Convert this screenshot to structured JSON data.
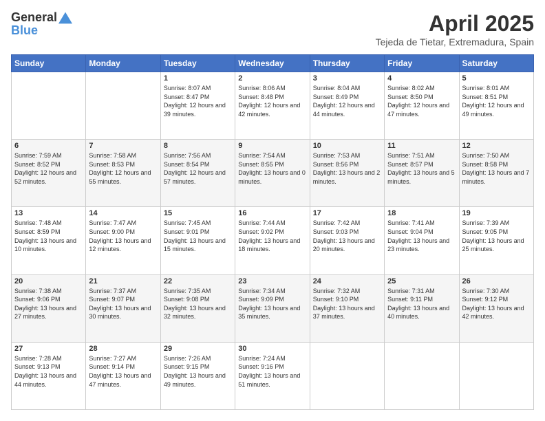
{
  "logo": {
    "line1": "General",
    "line2": "Blue"
  },
  "title": "April 2025",
  "subtitle": "Tejeda de Tietar, Extremadura, Spain",
  "days_header": [
    "Sunday",
    "Monday",
    "Tuesday",
    "Wednesday",
    "Thursday",
    "Friday",
    "Saturday"
  ],
  "weeks": [
    [
      {
        "num": "",
        "info": ""
      },
      {
        "num": "",
        "info": ""
      },
      {
        "num": "1",
        "info": "Sunrise: 8:07 AM\nSunset: 8:47 PM\nDaylight: 12 hours and 39 minutes."
      },
      {
        "num": "2",
        "info": "Sunrise: 8:06 AM\nSunset: 8:48 PM\nDaylight: 12 hours and 42 minutes."
      },
      {
        "num": "3",
        "info": "Sunrise: 8:04 AM\nSunset: 8:49 PM\nDaylight: 12 hours and 44 minutes."
      },
      {
        "num": "4",
        "info": "Sunrise: 8:02 AM\nSunset: 8:50 PM\nDaylight: 12 hours and 47 minutes."
      },
      {
        "num": "5",
        "info": "Sunrise: 8:01 AM\nSunset: 8:51 PM\nDaylight: 12 hours and 49 minutes."
      }
    ],
    [
      {
        "num": "6",
        "info": "Sunrise: 7:59 AM\nSunset: 8:52 PM\nDaylight: 12 hours and 52 minutes."
      },
      {
        "num": "7",
        "info": "Sunrise: 7:58 AM\nSunset: 8:53 PM\nDaylight: 12 hours and 55 minutes."
      },
      {
        "num": "8",
        "info": "Sunrise: 7:56 AM\nSunset: 8:54 PM\nDaylight: 12 hours and 57 minutes."
      },
      {
        "num": "9",
        "info": "Sunrise: 7:54 AM\nSunset: 8:55 PM\nDaylight: 13 hours and 0 minutes."
      },
      {
        "num": "10",
        "info": "Sunrise: 7:53 AM\nSunset: 8:56 PM\nDaylight: 13 hours and 2 minutes."
      },
      {
        "num": "11",
        "info": "Sunrise: 7:51 AM\nSunset: 8:57 PM\nDaylight: 13 hours and 5 minutes."
      },
      {
        "num": "12",
        "info": "Sunrise: 7:50 AM\nSunset: 8:58 PM\nDaylight: 13 hours and 7 minutes."
      }
    ],
    [
      {
        "num": "13",
        "info": "Sunrise: 7:48 AM\nSunset: 8:59 PM\nDaylight: 13 hours and 10 minutes."
      },
      {
        "num": "14",
        "info": "Sunrise: 7:47 AM\nSunset: 9:00 PM\nDaylight: 13 hours and 12 minutes."
      },
      {
        "num": "15",
        "info": "Sunrise: 7:45 AM\nSunset: 9:01 PM\nDaylight: 13 hours and 15 minutes."
      },
      {
        "num": "16",
        "info": "Sunrise: 7:44 AM\nSunset: 9:02 PM\nDaylight: 13 hours and 18 minutes."
      },
      {
        "num": "17",
        "info": "Sunrise: 7:42 AM\nSunset: 9:03 PM\nDaylight: 13 hours and 20 minutes."
      },
      {
        "num": "18",
        "info": "Sunrise: 7:41 AM\nSunset: 9:04 PM\nDaylight: 13 hours and 23 minutes."
      },
      {
        "num": "19",
        "info": "Sunrise: 7:39 AM\nSunset: 9:05 PM\nDaylight: 13 hours and 25 minutes."
      }
    ],
    [
      {
        "num": "20",
        "info": "Sunrise: 7:38 AM\nSunset: 9:06 PM\nDaylight: 13 hours and 27 minutes."
      },
      {
        "num": "21",
        "info": "Sunrise: 7:37 AM\nSunset: 9:07 PM\nDaylight: 13 hours and 30 minutes."
      },
      {
        "num": "22",
        "info": "Sunrise: 7:35 AM\nSunset: 9:08 PM\nDaylight: 13 hours and 32 minutes."
      },
      {
        "num": "23",
        "info": "Sunrise: 7:34 AM\nSunset: 9:09 PM\nDaylight: 13 hours and 35 minutes."
      },
      {
        "num": "24",
        "info": "Sunrise: 7:32 AM\nSunset: 9:10 PM\nDaylight: 13 hours and 37 minutes."
      },
      {
        "num": "25",
        "info": "Sunrise: 7:31 AM\nSunset: 9:11 PM\nDaylight: 13 hours and 40 minutes."
      },
      {
        "num": "26",
        "info": "Sunrise: 7:30 AM\nSunset: 9:12 PM\nDaylight: 13 hours and 42 minutes."
      }
    ],
    [
      {
        "num": "27",
        "info": "Sunrise: 7:28 AM\nSunset: 9:13 PM\nDaylight: 13 hours and 44 minutes."
      },
      {
        "num": "28",
        "info": "Sunrise: 7:27 AM\nSunset: 9:14 PM\nDaylight: 13 hours and 47 minutes."
      },
      {
        "num": "29",
        "info": "Sunrise: 7:26 AM\nSunset: 9:15 PM\nDaylight: 13 hours and 49 minutes."
      },
      {
        "num": "30",
        "info": "Sunrise: 7:24 AM\nSunset: 9:16 PM\nDaylight: 13 hours and 51 minutes."
      },
      {
        "num": "",
        "info": ""
      },
      {
        "num": "",
        "info": ""
      },
      {
        "num": "",
        "info": ""
      }
    ]
  ]
}
